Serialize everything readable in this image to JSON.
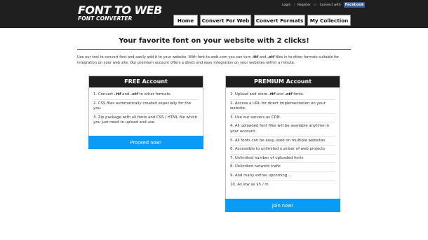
{
  "header": {
    "logo_main": "FONT TO WEB",
    "logo_sub": "FONT CONVERTER",
    "links": {
      "login": "Login",
      "register": "Register",
      "or": "or",
      "connect": "Connect with",
      "facebook": "Facebook",
      "sep": "|"
    },
    "nav": [
      "Home",
      "Convert For Web",
      "Convert Formats",
      "My Collection"
    ]
  },
  "main": {
    "headline": "Your favorite font on your website with 2 clicks!",
    "intro_a": "Use our tool to convert font and easily add it to your website. With font-to-web.com you can turn ",
    "intro_ttf": ".ttf",
    "intro_and": " and ",
    "intro_otf": ".otf",
    "intro_b": " files in to other formats suitable for integration on your web site. Our premium account offers a direct and easy integration on your websites within a minute."
  },
  "free": {
    "title": "FREE Account",
    "items": [
      {
        "pre": "1. Convert ",
        "ttf": ".ttf",
        "mid": " and ",
        "otf": ".otf",
        "post": " to other formats."
      },
      {
        "text": "2. CSS files automatically created especially for the you."
      },
      {
        "text": "3. Zip package with all fonts and CSS / HTML file which you just need to upload and use."
      }
    ],
    "cta": "Proceed now!"
  },
  "premium": {
    "title": "PREMIUM Account",
    "items": [
      {
        "pre": "1. Upload and store ",
        "ttf": ".ttf",
        "mid": " and ",
        "otf": ".otf",
        "post": " fonts."
      },
      {
        "text": "2. Access a URL for direct implementation on your website."
      },
      {
        "text": "3. Use our servers as CDN."
      },
      {
        "text": "4. All uploaded font files will be available anytime in your account."
      },
      {
        "text": "5. All fonts can be easy used on multiple websites."
      },
      {
        "text": "6. Accessible to unlimited number of web projects"
      },
      {
        "text": "7. Unlimited number of uploaded fonts"
      },
      {
        "text": "8. Unlimited network trafic"
      },
      {
        "text": "9. And many extras upcoming ..."
      },
      {
        "text": "10. As low as $5 / m ."
      }
    ],
    "cta": "Join now!"
  }
}
